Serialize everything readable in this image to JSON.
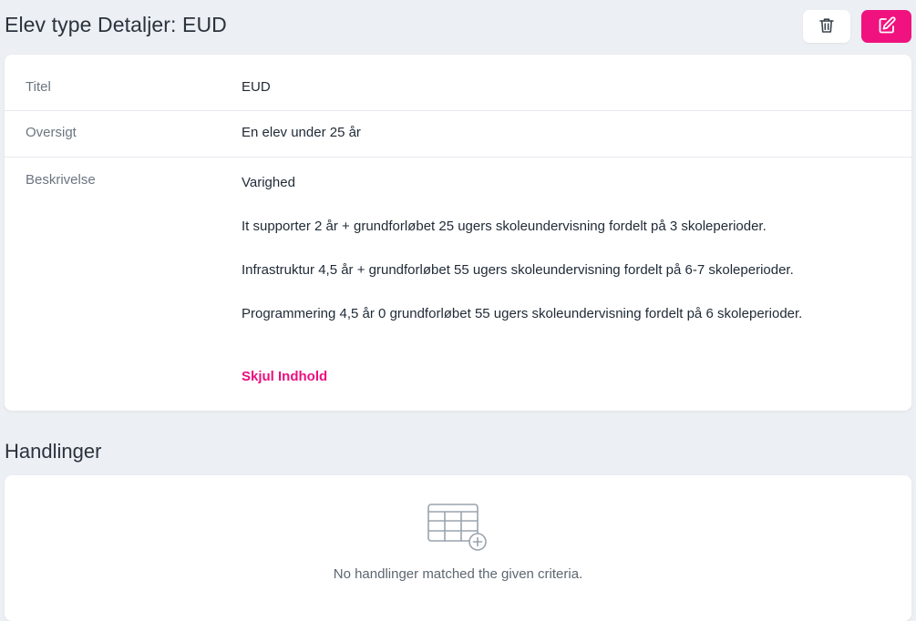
{
  "header": {
    "title": "Elev type Detaljer: EUD",
    "delete_icon": "trash-icon",
    "edit_icon": "edit-icon",
    "accent_color": "#f0127e"
  },
  "details": {
    "rows": [
      {
        "label": "Titel",
        "value": "EUD"
      },
      {
        "label": "Oversigt",
        "value": "En elev under 25 år"
      },
      {
        "label": "Beskrivelse"
      }
    ],
    "description": {
      "heading": "Varighed",
      "lines": [
        "It supporter 2 år + grundforløbet 25 ugers skoleundervisning fordelt på 3 skoleperioder.",
        "Infrastruktur 4,5 år + grundforløbet 55 ugers skoleundervisning fordelt på 6-7 skoleperioder.",
        "Programmering 4,5 år 0 grundforløbet 55 ugers skoleundervisning fordelt på 6 skoleperioder."
      ],
      "toggle_label": "Skjul Indhold"
    }
  },
  "actions": {
    "title": "Handlinger",
    "empty_icon": "table-add-icon",
    "empty_message": "No handlinger matched the given criteria."
  }
}
